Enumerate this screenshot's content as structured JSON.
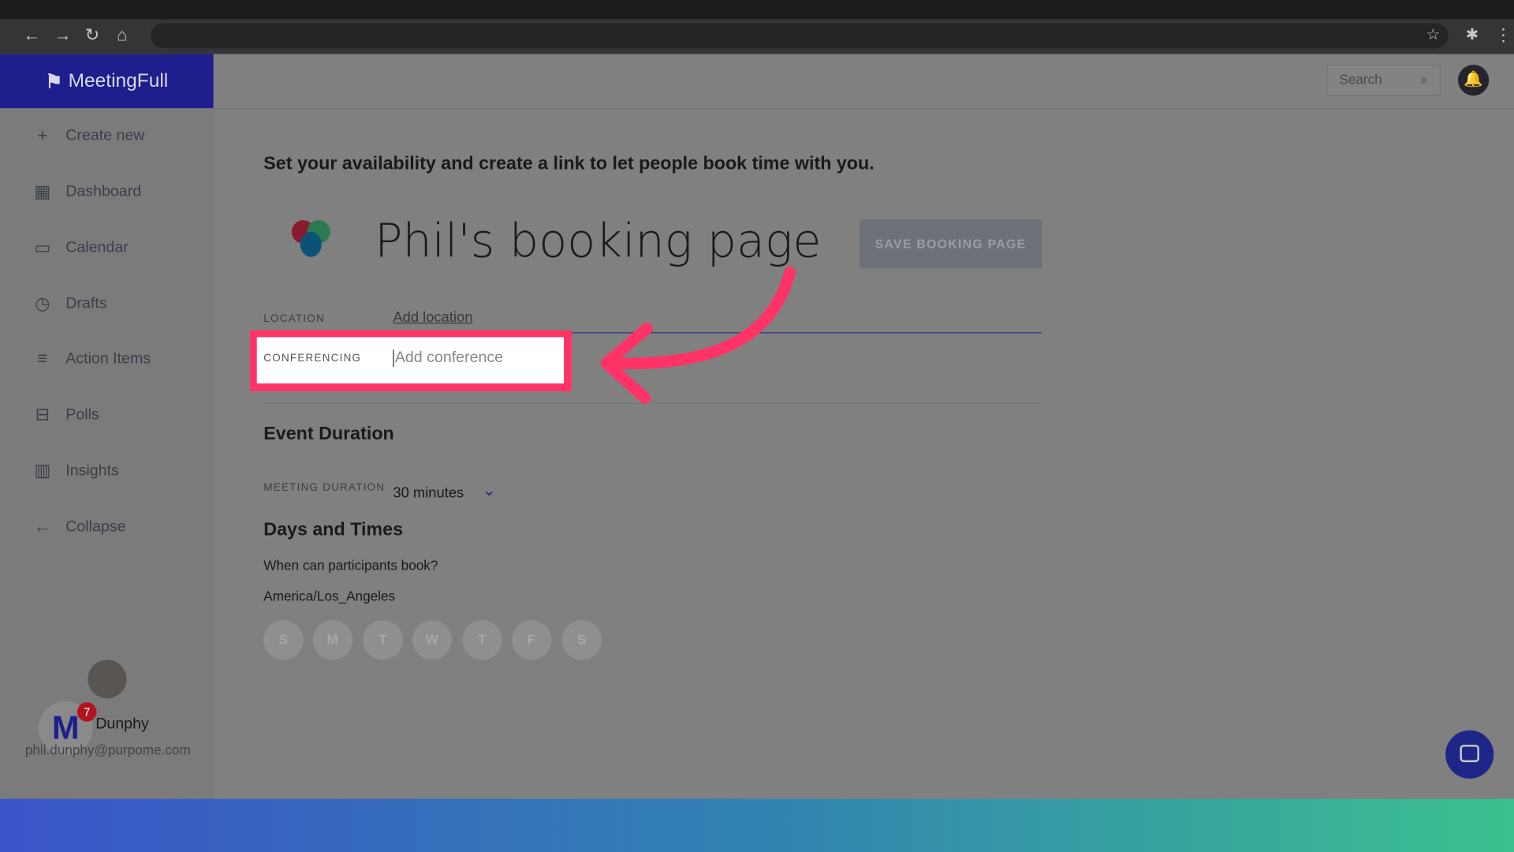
{
  "app": {
    "name": "MeetingFull"
  },
  "sidebar": {
    "items": [
      {
        "label": "Create new",
        "icon": "plus-icon"
      },
      {
        "label": "Dashboard",
        "icon": "grid-icon"
      },
      {
        "label": "Calendar",
        "icon": "calendar-icon"
      },
      {
        "label": "Drafts",
        "icon": "clock-icon"
      },
      {
        "label": "Action Items",
        "icon": "list-icon"
      },
      {
        "label": "Polls",
        "icon": "ballot-box-icon"
      },
      {
        "label": "Insights",
        "icon": "bar-chart-icon"
      },
      {
        "label": "Collapse",
        "icon": "arrow-left-icon"
      }
    ],
    "user": {
      "name": "Dunphy",
      "email": "phil.dunphy@purpome.com",
      "badge": "7"
    }
  },
  "header": {
    "search_placeholder": "Search"
  },
  "main": {
    "intro": "Set your availability and create a link to let people book time with you.",
    "title": "Phil's booking page",
    "save_label": "SAVE BOOKING PAGE",
    "location_label": "LOCATION",
    "location_link": "Add location",
    "conferencing_label": "CONFERENCING",
    "conference_placeholder": "Add conference",
    "duration_heading": "Event Duration",
    "duration_label": "MEETING DURATION",
    "duration_value": "30 minutes",
    "days_heading": "Days and Times",
    "days_question": "When can participants book?",
    "timezone": "America/Los_Angeles",
    "days": [
      "S",
      "M",
      "T",
      "W",
      "T",
      "F",
      "S"
    ]
  },
  "colors": {
    "highlight": "#ff3366",
    "brand": "#1e1e8c"
  }
}
